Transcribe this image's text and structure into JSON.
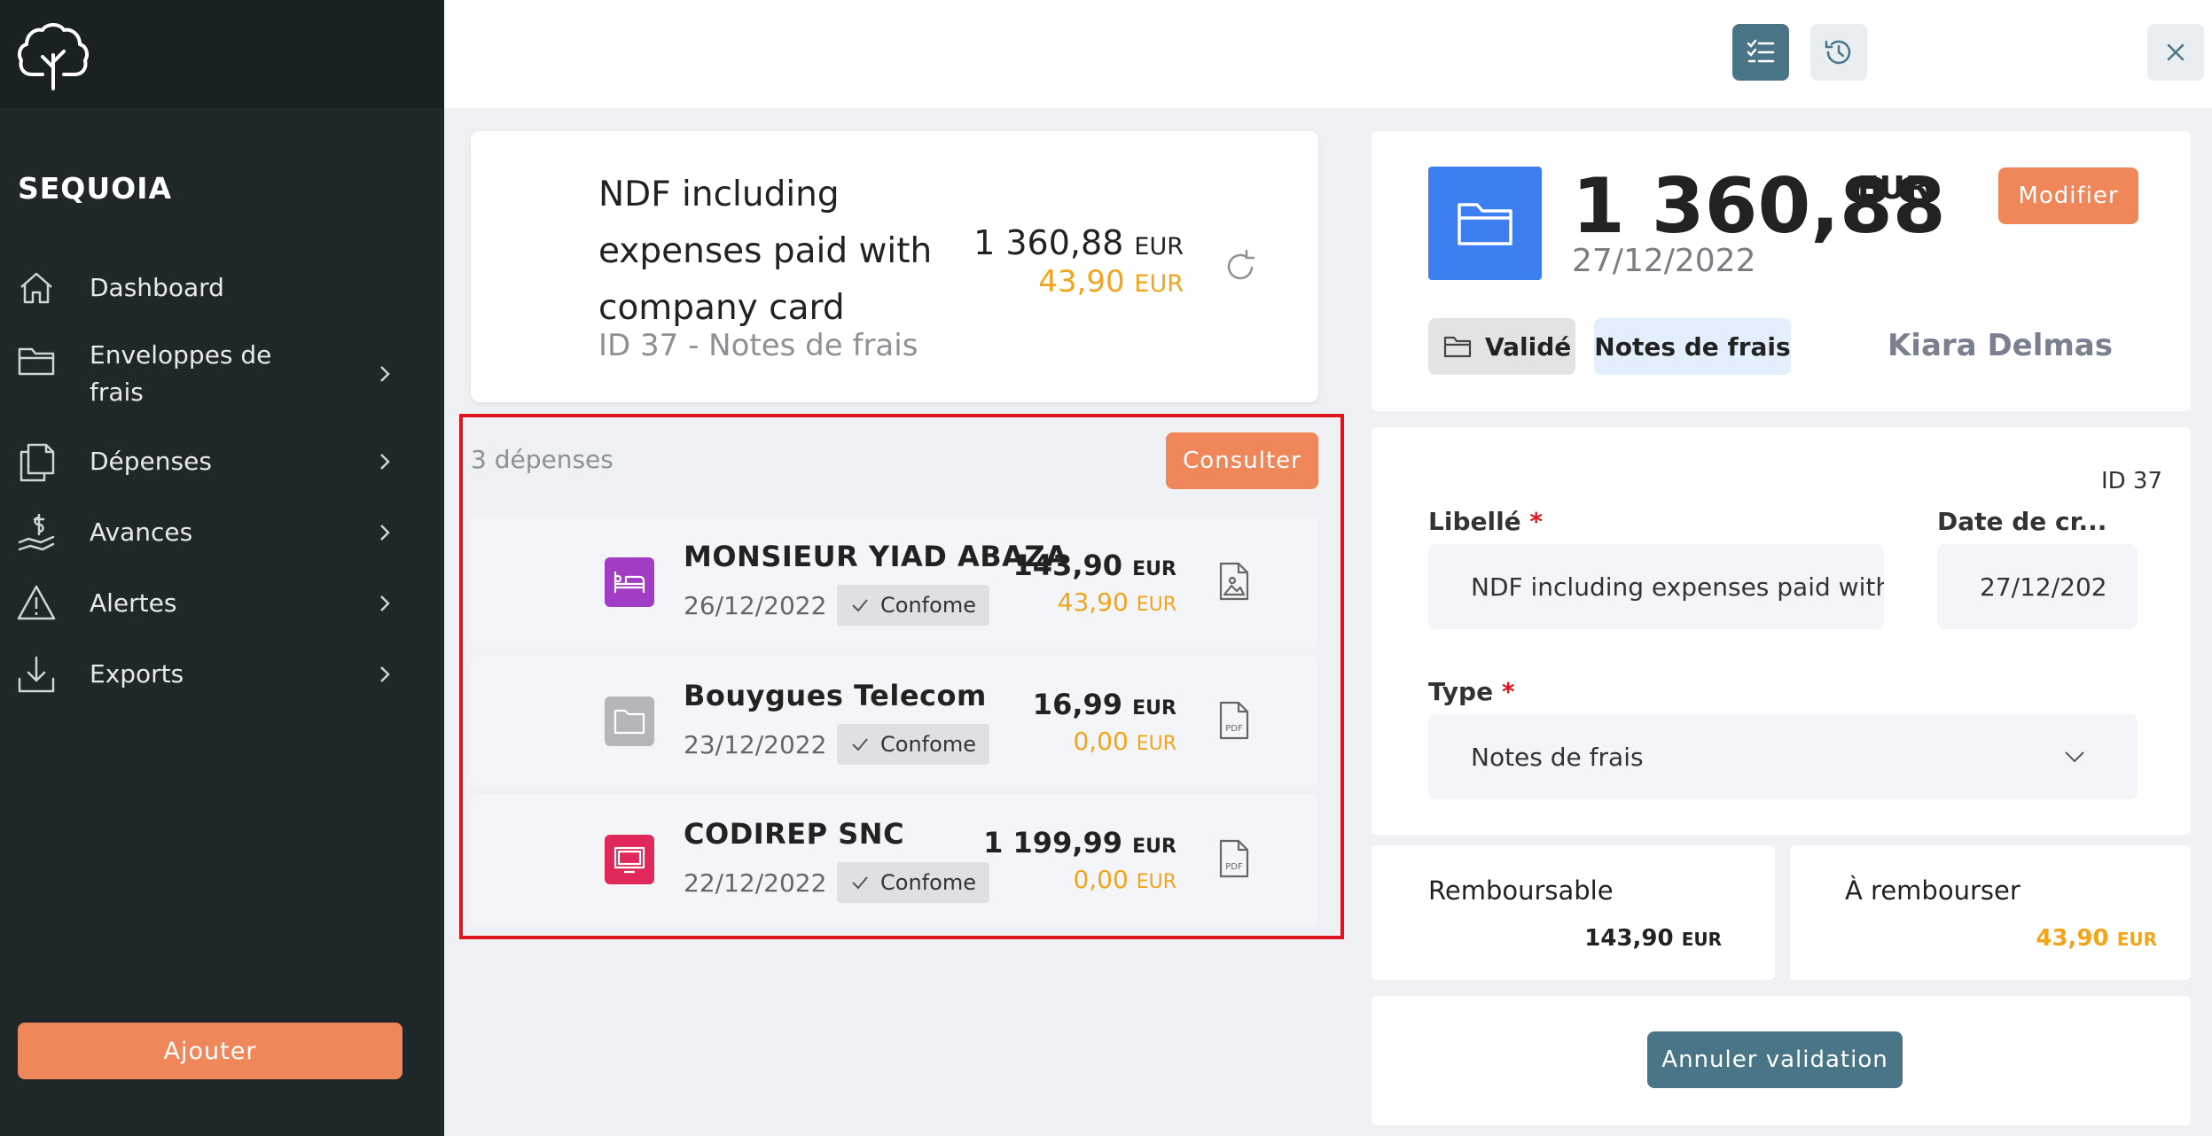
{
  "brand": "SEQUOIA",
  "nav": {
    "dashboard": "Dashboard",
    "envelopes_line1": "Enveloppes de",
    "envelopes_line2": "frais",
    "expenses": "Dépenses",
    "advances": "Avances",
    "alerts": "Alertes",
    "exports": "Exports"
  },
  "add_button": "Ajouter",
  "envelope": {
    "title": "NDF including expenses paid with company card",
    "subtitle": "ID 37 - Notes de frais",
    "amount": "1 360,88",
    "amount_currency": "EUR",
    "refundable": "43,90",
    "refundable_currency": "EUR"
  },
  "expenses": {
    "count_label": "3 dépenses",
    "consult_button": "Consulter",
    "items": [
      {
        "name": "MONSIEUR YIAD ABAZA",
        "date": "26/12/2022",
        "status": "Confome",
        "amount": "143,90",
        "currency": "EUR",
        "refund": "43,90",
        "refund_currency": "EUR",
        "icon_color": "#a33cc4",
        "doc": "image"
      },
      {
        "name": "Bouygues Telecom",
        "date": "23/12/2022",
        "status": "Confome",
        "amount": "16,99",
        "currency": "EUR",
        "refund": "0,00",
        "refund_currency": "EUR",
        "icon_color": "#b5b6bb",
        "doc": "pdf"
      },
      {
        "name": "CODIREP SNC",
        "date": "22/12/2022",
        "status": "Confome",
        "amount": "1 199,99",
        "currency": "EUR",
        "refund": "0,00",
        "refund_currency": "EUR",
        "icon_color": "#e0285a",
        "doc": "pdf"
      }
    ]
  },
  "detail": {
    "amount": "1 360,88",
    "currency": "EUR",
    "date": "27/12/2022",
    "modify_button": "Modifier",
    "status_chip": "Validé",
    "type_chip": "Notes de frais",
    "user": "Kiara Delmas",
    "id": "ID 37",
    "label_title": "Libellé",
    "label_value": "NDF including expenses paid with",
    "date_title": "Date de cr...",
    "date_value": "27/12/202",
    "type_title": "Type",
    "type_value": "Notes de frais",
    "required_mark": "*"
  },
  "summary": {
    "refundable_label": "Remboursable",
    "refundable_value": "143,90",
    "to_refund_label": "À rembourser",
    "to_refund_value": "43,90",
    "currency": "EUR"
  },
  "cancel_button": "Annuler validation",
  "colors": {
    "accent": "#f0875a",
    "sidebar": "#1f272b",
    "primary_dark": "#4a7587",
    "folder_blue": "#3d7ff0",
    "refund_orange": "#f2a51a"
  }
}
